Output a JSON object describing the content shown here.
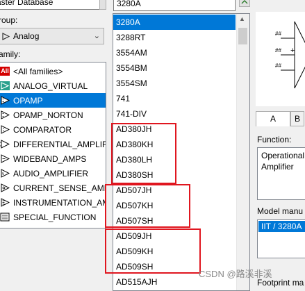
{
  "database": {
    "value": "aster Database"
  },
  "group": {
    "label": "roup:",
    "value": "Analog"
  },
  "family": {
    "label": "amily:",
    "items": [
      {
        "icon": "all-families-icon",
        "icon_text": "All",
        "label": "<All families>"
      },
      {
        "icon": "analog-virtual-icon",
        "label": "ANALOG_VIRTUAL"
      },
      {
        "icon": "opamp-icon",
        "label": "OPAMP",
        "selected": true
      },
      {
        "icon": "opamp-norton-icon",
        "label": "OPAMP_NORTON"
      },
      {
        "icon": "comparator-icon",
        "label": "COMPARATOR"
      },
      {
        "icon": "differential-amplifier-icon",
        "label": "DIFFERENTIAL_AMPLIFI"
      },
      {
        "icon": "wideband-amps-icon",
        "label": "WIDEBAND_AMPS"
      },
      {
        "icon": "audio-amplifier-icon",
        "label": "AUDIO_AMPLIFIER"
      },
      {
        "icon": "current-sense-amp-icon",
        "label": "CURRENT_SENSE_AMPL"
      },
      {
        "icon": "instrumentation-amp-icon",
        "label": "INSTRUMENTATION_AM"
      },
      {
        "icon": "special-function-icon",
        "label": "SPECIAL_FUNCTION"
      }
    ]
  },
  "component": {
    "value": "3280A",
    "items": [
      {
        "label": "3280A",
        "selected": true
      },
      {
        "label": "3288RT"
      },
      {
        "label": "3554AM"
      },
      {
        "label": "3554BM"
      },
      {
        "label": "3554SM"
      },
      {
        "label": "741"
      },
      {
        "label": "741-DIV"
      },
      {
        "label": "AD380JH"
      },
      {
        "label": "AD380KH"
      },
      {
        "label": "AD380LH"
      },
      {
        "label": "AD380SH"
      },
      {
        "label": "AD507JH"
      },
      {
        "label": "AD507KH"
      },
      {
        "label": "AD507SH"
      },
      {
        "label": "AD509JH"
      },
      {
        "label": "AD509KH"
      },
      {
        "label": "AD509SH"
      },
      {
        "label": "AD515AJH"
      }
    ]
  },
  "symbol_preview": {
    "pin_labels": [
      "##",
      "##",
      "##"
    ]
  },
  "tabs": {
    "a": "A",
    "b": "B"
  },
  "function": {
    "label": "Function:",
    "text_line1": "Operational",
    "text_line2": "Amplifier"
  },
  "model_manufacturer": {
    "label": "Model manu",
    "value": "IIT / 3280A"
  },
  "footprint": {
    "label": "Footprint ma"
  },
  "watermark": {
    "text": "CSDN @路溪非溪"
  },
  "colors": {
    "selection": "#0078d7",
    "highlight_box": "#e0161f"
  }
}
